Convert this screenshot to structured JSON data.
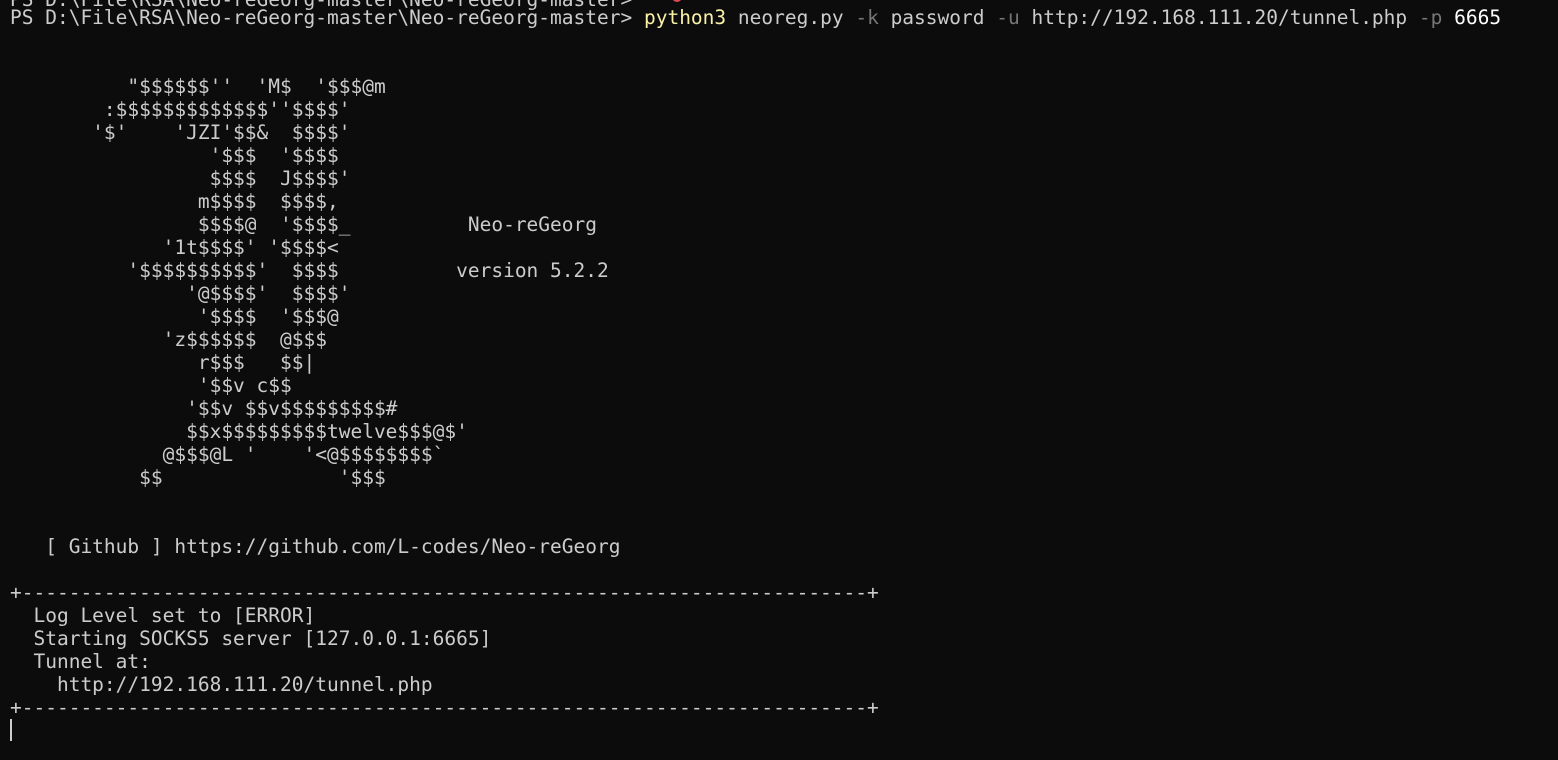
{
  "terminal": {
    "clipped_line": "PS D:\\File\\RSA\\Neo-reGeorg-master\\Neo-reGeorg-master>",
    "prompt": "PS D:\\File\\RSA\\Neo-reGeorg-master\\Neo-reGeorg-master> ",
    "command": {
      "exe": "python3",
      "script": "neoreg.py",
      "key_flag": "-k",
      "key_value": "password",
      "url_flag": "-u",
      "url_value": "http://192.168.111.20/tunnel.php",
      "port_flag": "-p",
      "port_value": "6665"
    },
    "banner": [
      "          \"$$$$$$''  'M$  '$$$@m",
      "        :$$$$$$$$$$$$$''$$$$'",
      "       '$'    'JZI'$$&  $$$$'",
      "                 '$$$  '$$$$",
      "                 $$$$  J$$$$'",
      "                m$$$$  $$$$,",
      "                $$$$@  '$$$$_          Neo-reGeorg",
      "             '1t$$$$' '$$$$<",
      "          '$$$$$$$$$$'  $$$$          version 5.2.2",
      "               '@$$$$'  $$$$'",
      "                '$$$$  '$$$@",
      "             'z$$$$$$  @$$$",
      "                r$$$   $$|",
      "                '$$v c$$",
      "               '$$v $$v$$$$$$$$$#",
      "               $$x$$$$$$$$$twelve$$$@$'",
      "             @$$$@L '    '<@$$$$$$$$`",
      "           $$               '$$$"
    ],
    "github_line": "   [ Github ] https://github.com/L-codes/Neo-reGeorg",
    "border": "+------------------------------------------------------------------------+",
    "log_lines": [
      "  Log Level set to [ERROR]",
      "  Starting SOCKS5 server [127.0.0.1:6665]",
      "  Tunnel at:",
      "    http://192.168.111.20/tunnel.php"
    ],
    "colors": {
      "background": "#0c0c0c",
      "foreground": "#cccccc",
      "command_exe": "#f9f1a5",
      "flag": "#767676",
      "number": "#ffffff"
    }
  }
}
